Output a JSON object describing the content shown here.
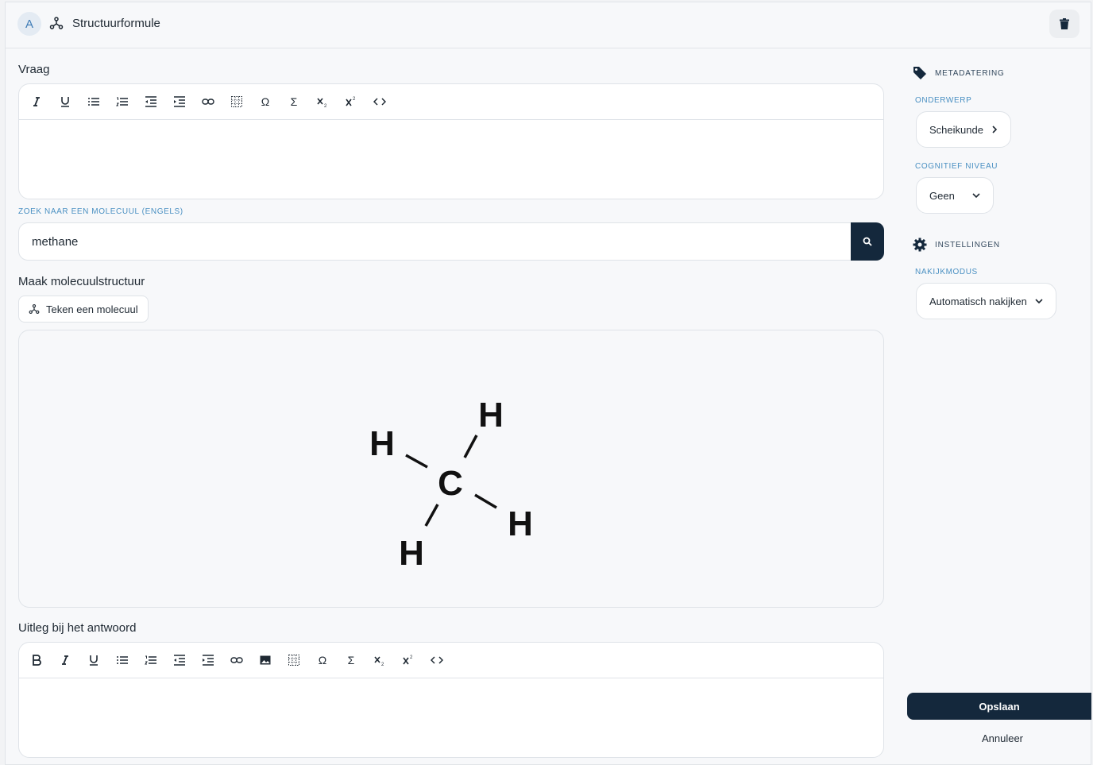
{
  "header": {
    "badge_letter": "A",
    "title": "Structuurformule"
  },
  "question": {
    "label": "Vraag"
  },
  "search": {
    "label": "ZOEK NAAR EEN MOLECUUL (ENGELS)",
    "value": "methane"
  },
  "structure": {
    "label": "Maak molecuulstructuur",
    "draw_button": "Teken een molecuul",
    "atoms": {
      "center": "C",
      "top": "H",
      "left": "H",
      "right": "H",
      "bottom": "H"
    }
  },
  "explanation": {
    "label": "Uitleg bij het antwoord"
  },
  "sidebar": {
    "metadata_heading": "METADATERING",
    "subject_label": "ONDERWERP",
    "subject_value": "Scheikunde",
    "cognitive_label": "COGNITIEF NIVEAU",
    "cognitive_value": "Geen",
    "settings_heading": "INSTELLINGEN",
    "grading_label": "NAKIJKMODUS",
    "grading_value": "Automatisch nakijken"
  },
  "actions": {
    "save": "Opslaan",
    "cancel": "Annuleer"
  },
  "toolbar_tooltips": {
    "symbols": {
      "omega": "Ω",
      "sigma": "Σ"
    }
  }
}
